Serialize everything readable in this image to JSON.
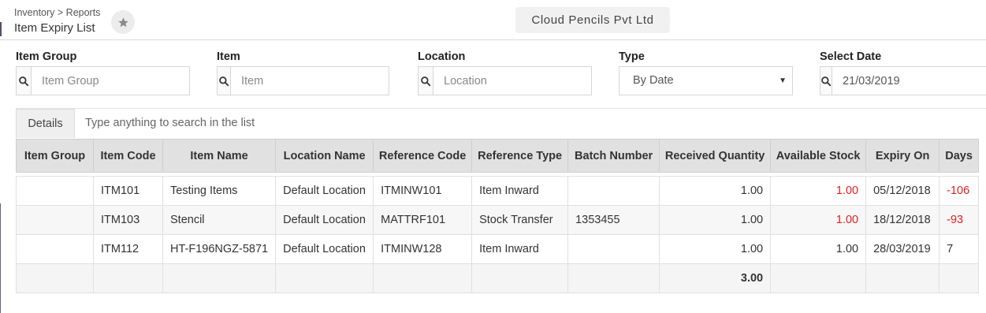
{
  "header": {
    "breadcrumb": "Inventory > Reports",
    "title": "Item Expiry List",
    "company": "Cloud Pencils Pvt Ltd",
    "favorite_icon": "star-icon"
  },
  "filters": {
    "item_group": {
      "label": "Item Group",
      "placeholder": "Item Group"
    },
    "item": {
      "label": "Item",
      "placeholder": "Item"
    },
    "location": {
      "label": "Location",
      "placeholder": "Location"
    },
    "type": {
      "label": "Type",
      "value": "By Date"
    },
    "select_date": {
      "label": "Select Date",
      "value": "21/03/2019"
    }
  },
  "details": {
    "tab_label": "Details",
    "search_placeholder": "Type anything to search in the list"
  },
  "table": {
    "columns": [
      "Item Group",
      "Item Code",
      "Item Name",
      "Location Name",
      "Reference Code",
      "Reference Type",
      "Batch Number",
      "Received Quantity",
      "Available Stock",
      "Expiry On",
      "Days"
    ],
    "rows": [
      {
        "item_group": "",
        "item_code": "ITM101",
        "item_name": "Testing Items",
        "location": "Default Location",
        "ref_code": "ITMINW101",
        "ref_type": "Item Inward",
        "batch": "",
        "received": "1.00",
        "available": "1.00",
        "expiry": "05/12/2018",
        "days": "-106"
      },
      {
        "item_group": "",
        "item_code": "ITM103",
        "item_name": "Stencil",
        "location": "Default Location",
        "ref_code": "MATTRF101",
        "ref_type": "Stock Transfer",
        "batch": "1353455",
        "received": "1.00",
        "available": "1.00",
        "expiry": "18/12/2018",
        "days": "-93"
      },
      {
        "item_group": "",
        "item_code": "ITM112",
        "item_name": "HT-F196NGZ-5871",
        "location": "Default Location",
        "ref_code": "ITMINW128",
        "ref_type": "Item Inward",
        "batch": "",
        "received": "1.00",
        "available": "1.00",
        "expiry": "28/03/2019",
        "days": "7"
      }
    ],
    "total_received": "3.00"
  },
  "colors": {
    "negative": "#e02020",
    "header_bg": "#e1e1e1"
  }
}
